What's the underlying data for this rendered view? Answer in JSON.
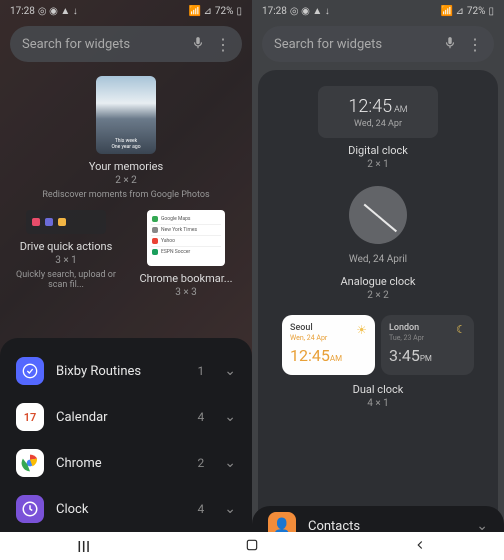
{
  "statusbar": {
    "time": "17:28",
    "icons": "◎ ◉ ▲ ↓",
    "battery": "72%",
    "signal": "📶 ⊿"
  },
  "search": {
    "placeholder": "Search for widgets"
  },
  "memories": {
    "caption1": "This week",
    "caption2": "One year ago",
    "title": "Your memories",
    "size": "2 × 2",
    "desc": "Rediscover moments from Google Photos"
  },
  "drive": {
    "title": "Drive quick actions",
    "size": "3 × 1",
    "desc": "Quickly search, upload or scan fil..."
  },
  "chromebm": {
    "title": "Chrome bookmar...",
    "size": "3 × 3",
    "rows": [
      "Google Maps",
      "New York Times",
      "Yahoo",
      "ESPN Soccer"
    ]
  },
  "apps": [
    {
      "name": "Bixby Routines",
      "count": "1"
    },
    {
      "name": "Calendar",
      "count": "4"
    },
    {
      "name": "Chrome",
      "count": "2"
    },
    {
      "name": "Clock",
      "count": "4"
    }
  ],
  "digclock": {
    "time": "12:45",
    "am": "AM",
    "date": "Wed, 24 Apr",
    "title": "Digital clock",
    "size": "2 × 1"
  },
  "anaclock": {
    "date": "Wed, 24 April",
    "title": "Analogue clock",
    "size": "2 × 2"
  },
  "dualclock": {
    "title": "Dual clock",
    "size": "4 × 1",
    "seoul": {
      "city": "Seoul",
      "date": "Wen, 24 Apr",
      "time": "12:45",
      "pm": "AM"
    },
    "london": {
      "city": "London",
      "date": "Tue, 23 Apr",
      "time": "3:45",
      "pm": "PM"
    }
  },
  "contacts": {
    "name": "Contacts"
  }
}
